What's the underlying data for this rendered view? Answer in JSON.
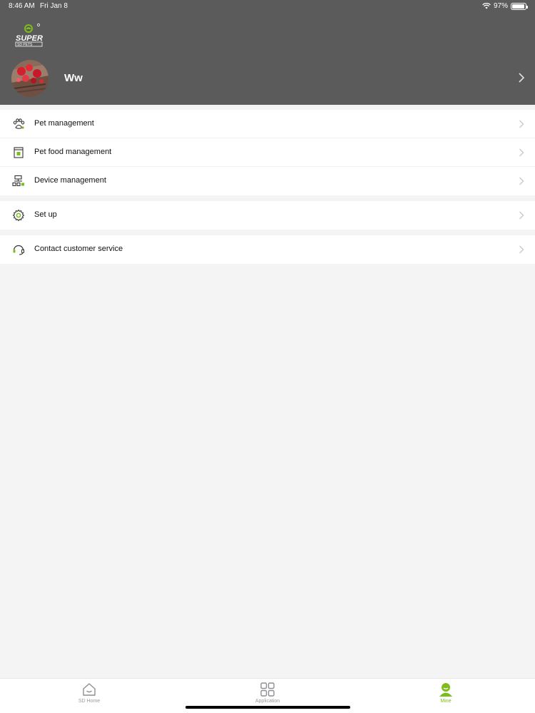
{
  "status_bar": {
    "time": "8:46 AM",
    "date": "Fri Jan 8",
    "battery_text": "97%",
    "battery_level": 0.97
  },
  "brand": {
    "accent": "#7cbd1d",
    "header_bg": "#5b5b5c",
    "logo_lines": [
      "SUPER",
      "SD PETS"
    ]
  },
  "profile": {
    "username": "Ww",
    "avatar_icon": "avatar-photo",
    "chevron_icon": "chevron-right-icon"
  },
  "menu_groups": [
    {
      "items": [
        {
          "label": "Pet management",
          "icon": "paw-icon"
        },
        {
          "label": "Pet food management",
          "icon": "food-bin-icon"
        },
        {
          "label": "Device management",
          "icon": "device-network-icon"
        }
      ]
    },
    {
      "items": [
        {
          "label": "Set up",
          "icon": "gear-icon"
        }
      ]
    },
    {
      "items": [
        {
          "label": "Contact customer service",
          "icon": "headset-icon"
        }
      ]
    }
  ],
  "tabbar": {
    "tabs": [
      {
        "label": "SD Home",
        "icon": "home-icon",
        "active": false
      },
      {
        "label": "Application",
        "icon": "grid-icon",
        "active": false
      },
      {
        "label": "Mine",
        "icon": "person-icon",
        "active": true
      }
    ]
  }
}
